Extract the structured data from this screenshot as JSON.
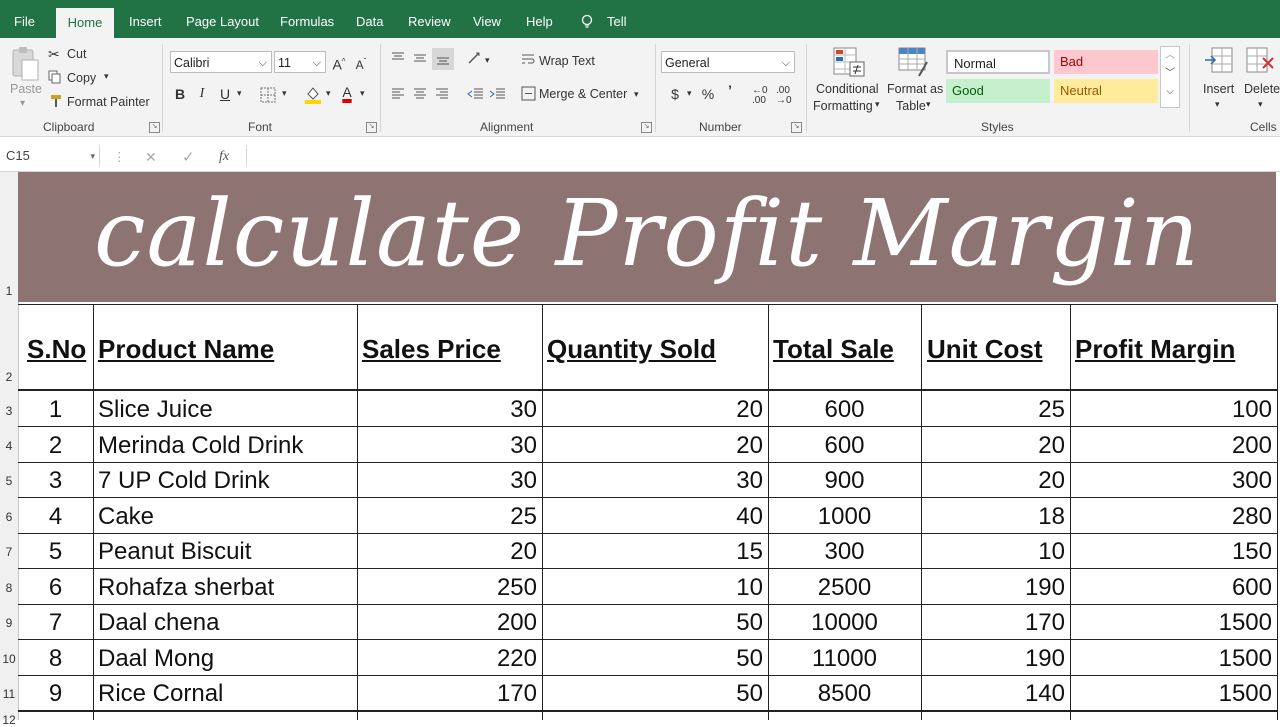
{
  "ribbon": {
    "tabs": [
      "File",
      "Home",
      "Insert",
      "Page Layout",
      "Formulas",
      "Data",
      "Review",
      "View",
      "Help"
    ],
    "active_tab": "Home",
    "tell_me": "Tell me what you want to do",
    "clipboard": {
      "paste": "Paste",
      "cut": "Cut",
      "copy": "Copy",
      "format_painter": "Format Painter",
      "label": "Clipboard"
    },
    "font": {
      "name": "Calibri",
      "size": "11",
      "label": "Font",
      "bold": "B",
      "italic": "I",
      "underline": "U",
      "grow": "A",
      "shrink": "A",
      "color": "A"
    },
    "alignment": {
      "wrap_text": "Wrap Text",
      "merge_center": "Merge & Center",
      "label": "Alignment"
    },
    "number": {
      "format": "General",
      "currency": "$",
      "percent": "%",
      "comma": "’",
      "label": "Number"
    },
    "styles": {
      "conditional": [
        "Conditional",
        "Formatting"
      ],
      "format_table": [
        "Format as",
        "Table"
      ],
      "label": "Styles",
      "cells": [
        {
          "name": "Normal",
          "bg": "#ffffff",
          "fg": "#222222"
        },
        {
          "name": "Bad",
          "bg": "#ffc7ce",
          "fg": "#9c0006"
        },
        {
          "name": "Good",
          "bg": "#c6efce",
          "fg": "#006100"
        },
        {
          "name": "Neutral",
          "bg": "#ffeb9c",
          "fg": "#9c5700"
        }
      ]
    },
    "cells_group": {
      "insert": "Insert",
      "delete": "Delete",
      "label": "Cells"
    }
  },
  "formula_bar": {
    "name_box": "C15",
    "fx": "fx",
    "content": ""
  },
  "sheet": {
    "title": "calculate Profit Margin",
    "row_numbers": [
      "1",
      "2",
      "3",
      "4",
      "5",
      "6",
      "7",
      "8",
      "9",
      "10",
      "11",
      "12"
    ],
    "headers": [
      "S.No",
      "Product Name",
      "Sales Price",
      "Quantity Sold",
      "Total Sale",
      "Unit Cost",
      "Profit Margin"
    ],
    "rows": [
      [
        "1",
        "Slice Juice",
        "30",
        "20",
        "600",
        "25",
        "100"
      ],
      [
        "2",
        "Merinda Cold Drink",
        "30",
        "20",
        "600",
        "20",
        "200"
      ],
      [
        "3",
        "7 UP Cold Drink",
        "30",
        "30",
        "900",
        "20",
        "300"
      ],
      [
        "4",
        "Cake",
        "25",
        "40",
        "1000",
        "18",
        "280"
      ],
      [
        "5",
        "Peanut Biscuit",
        "20",
        "15",
        "300",
        "10",
        "150"
      ],
      [
        "6",
        "Rohafza sherbat",
        "250",
        "10",
        "2500",
        "190",
        "600"
      ],
      [
        "7",
        "Daal chena",
        "200",
        "50",
        "10000",
        "170",
        "1500"
      ],
      [
        "8",
        "Daal Mong",
        "220",
        "50",
        "11000",
        "190",
        "1500"
      ],
      [
        "9",
        "Rice Cornal",
        "170",
        "50",
        "8500",
        "140",
        "1500"
      ]
    ],
    "colors": {
      "title_band": "#8d7473",
      "ribbon_green": "#217346"
    }
  }
}
